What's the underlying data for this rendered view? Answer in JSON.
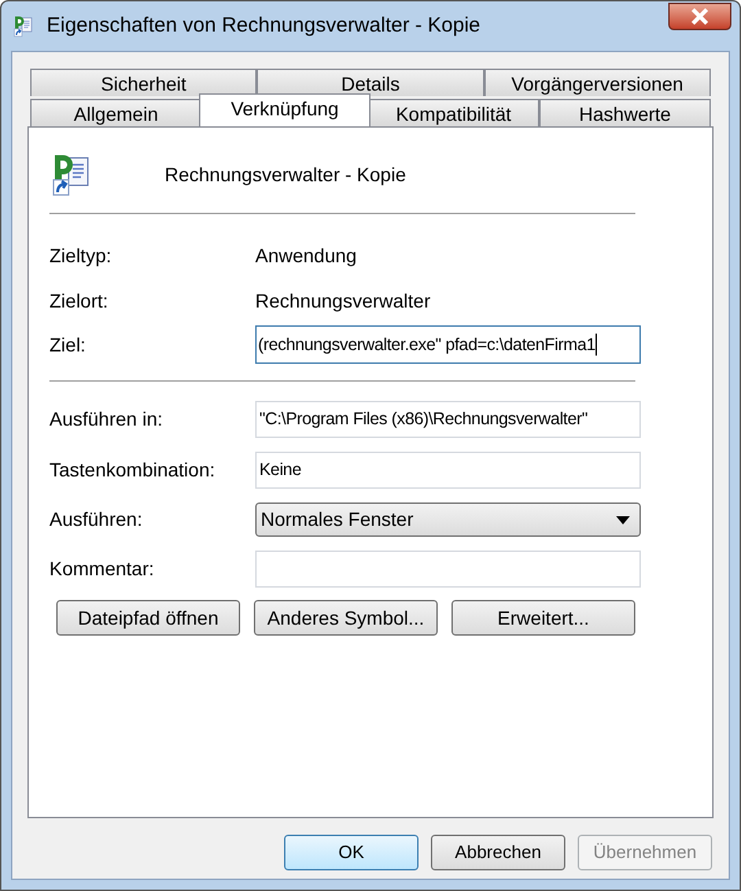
{
  "window": {
    "title": "Eigenschaften von Rechnungsverwalter - Kopie"
  },
  "tab_rows": [
    {
      "tabs": [
        {
          "label": "Sicherheit",
          "selected": false
        },
        {
          "label": "Details",
          "selected": false
        },
        {
          "label": "Vorgängerversionen",
          "selected": false
        }
      ]
    },
    {
      "tabs": [
        {
          "label": "Allgemein",
          "selected": false
        },
        {
          "label": "Verknüpfung",
          "selected": true
        },
        {
          "label": "Kompatibilität",
          "selected": false
        },
        {
          "label": "Hashwerte",
          "selected": false
        }
      ]
    }
  ],
  "shortcut_name": "Rechnungsverwalter - Kopie",
  "info_rows": [
    {
      "label": "Zieltyp:",
      "value": "Anwendung"
    },
    {
      "label": "Zielort:",
      "value": "Rechnungsverwalter"
    }
  ],
  "target": {
    "label": "Ziel:",
    "value": "(rechnungsverwalter.exe\" pfad=c:\\datenFirma1",
    "focused": true
  },
  "fields": [
    {
      "kind": "text",
      "label": "Ausführen in:",
      "value": "\"C:\\Program Files (x86)\\Rechnungsverwalter\""
    },
    {
      "kind": "text",
      "label": "Tastenkombination:",
      "value": "Keine"
    },
    {
      "kind": "select",
      "label": "Ausführen:",
      "value": "Normales Fenster"
    },
    {
      "kind": "text",
      "label": "Kommentar:"
    }
  ],
  "action_buttons": [
    "Dateipfad öffnen",
    "Anderes Symbol...",
    "Erweitert..."
  ],
  "dialog_buttons": [
    {
      "label": "OK",
      "default": true,
      "disabled": false
    },
    {
      "label": "Abbrechen",
      "default": false,
      "disabled": false
    },
    {
      "label": "Übernehmen",
      "default": false,
      "disabled": true
    }
  ]
}
